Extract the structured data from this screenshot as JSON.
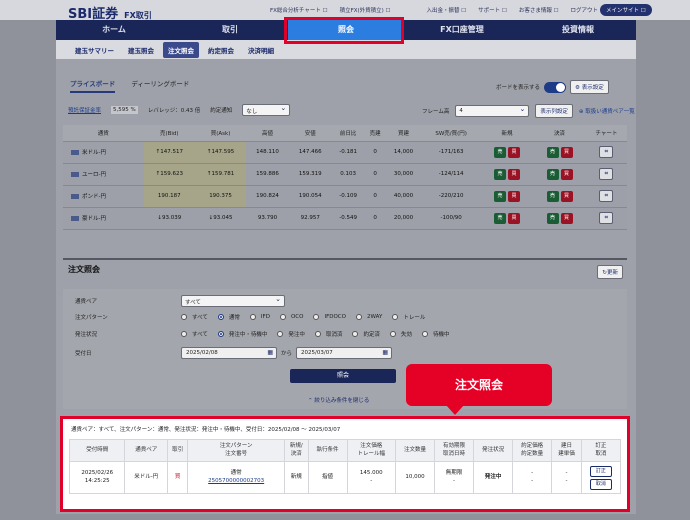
{
  "header": {
    "logo": "SBI証券",
    "logo_sub": "FX取引",
    "links": [
      "FX総合分析チャート ☐",
      "積立FX(外貨積立) ☐",
      "入出金・振替 ☐",
      "サポート ☐",
      "お客さま情報 ☐",
      "ログアウト"
    ],
    "main_site": "メインサイト ☐"
  },
  "nav": [
    "ホーム",
    "取引",
    "照会",
    "FX口座管理",
    "投資情報"
  ],
  "subnav": [
    "建玉サマリー",
    "建玉照会",
    "注文照会",
    "約定照会",
    "決済明細"
  ],
  "board": {
    "tabs": [
      "プライスボード",
      "ディーリングボード"
    ],
    "toggle_label": "ボードを表示する",
    "display_settings": "⚙ 表示設定",
    "margin_ratio_label": "預託保証金率",
    "margin_ratio": "5,595 %",
    "leverage": "レバレッジ：0.43 倍",
    "contract_notice_label": "約定通知",
    "contract_notice_value": "なし",
    "frame_label": "フレーム高",
    "frame_value": "4",
    "column_settings": "表示列設定",
    "add_pair": "⊕ 取扱い通貨ペア一覧"
  },
  "rate_table": {
    "headers": [
      "通貨",
      "売(Bid)",
      "買(Ask)",
      "高値",
      "安値",
      "前日比",
      "売建",
      "買建",
      "SW売/買(円)",
      "新規",
      "決済",
      "チャート"
    ],
    "rows": [
      {
        "pair": "米ドル-円",
        "bid": "↑147.517",
        "ask": "↑147.595",
        "high": "148.110",
        "low": "147.466",
        "change": "-0.181",
        "sell": "0",
        "buy": "14,000",
        "swap": "-171/163"
      },
      {
        "pair": "ユーロ-円",
        "bid": "↑159.623",
        "ask": "↑159.781",
        "high": "159.886",
        "low": "159.319",
        "change": "0.103",
        "sell": "0",
        "buy": "30,000",
        "swap": "-124/114"
      },
      {
        "pair": "ポンド-円",
        "bid": "190.187",
        "ask": "190.375",
        "high": "190.824",
        "low": "190.054",
        "change": "-0.109",
        "sell": "0",
        "buy": "40,000",
        "swap": "-220/210"
      },
      {
        "pair": "豪ドル-円",
        "bid": "↓93.039",
        "ask": "↓93.045",
        "high": "93.790",
        "low": "92.957",
        "change": "-0.549",
        "sell": "0",
        "buy": "20,000",
        "swap": "-100/90"
      }
    ],
    "sell_btn": "売",
    "buy_btn": "買"
  },
  "order_inquiry": {
    "title": "注文照会",
    "refresh": "↻更新",
    "pair_label": "通貨ペア",
    "pair_value": "すべて",
    "pattern_label": "注文パターン",
    "patterns": [
      "すべて",
      "通常",
      "IFD",
      "OCO",
      "IFDOCO",
      "2WAY",
      "トレール"
    ],
    "status_label": "発注状況",
    "statuses": [
      "すべて",
      "発注中・待機中",
      "発注中",
      "取消済",
      "約定済",
      "失効",
      "待機中"
    ],
    "date_label": "受付日",
    "date_from": "2025/02/08",
    "date_sep": "から",
    "date_to": "2025/03/07",
    "query_button": "照会",
    "narrow_link": "⌃ 絞り込み条件を閉じる"
  },
  "callout": "注文照会",
  "result": {
    "summary": "通貨ペア：すべて、注文パターン：通常、発注状況：発注中・待機中、受付日：2025/02/08 ～ 2025/03/07",
    "headers": [
      "受付時間",
      "通貨ペア",
      "取引",
      "注文パターン\n注文番号",
      "新規/\n決済",
      "執行条件",
      "注文価格\nトレール幅",
      "注文数量",
      "有効期限\n取消日時",
      "発注状況",
      "約定価格\n約定数量",
      "建日\n建単価",
      "訂正\n取消"
    ],
    "row": {
      "time": "2025/02/26\n14:25:25",
      "pair": "米ドル-円",
      "side": "買",
      "pattern": "通常",
      "order_no": "2505700000002703",
      "type": "新規",
      "condition": "指値",
      "price": "145.000\n-",
      "qty": "10,000",
      "expiry": "無期限\n-",
      "status": "発注中",
      "exec": "-\n-",
      "open": "-\n-",
      "edit": "訂正",
      "cancel": "取消"
    }
  }
}
